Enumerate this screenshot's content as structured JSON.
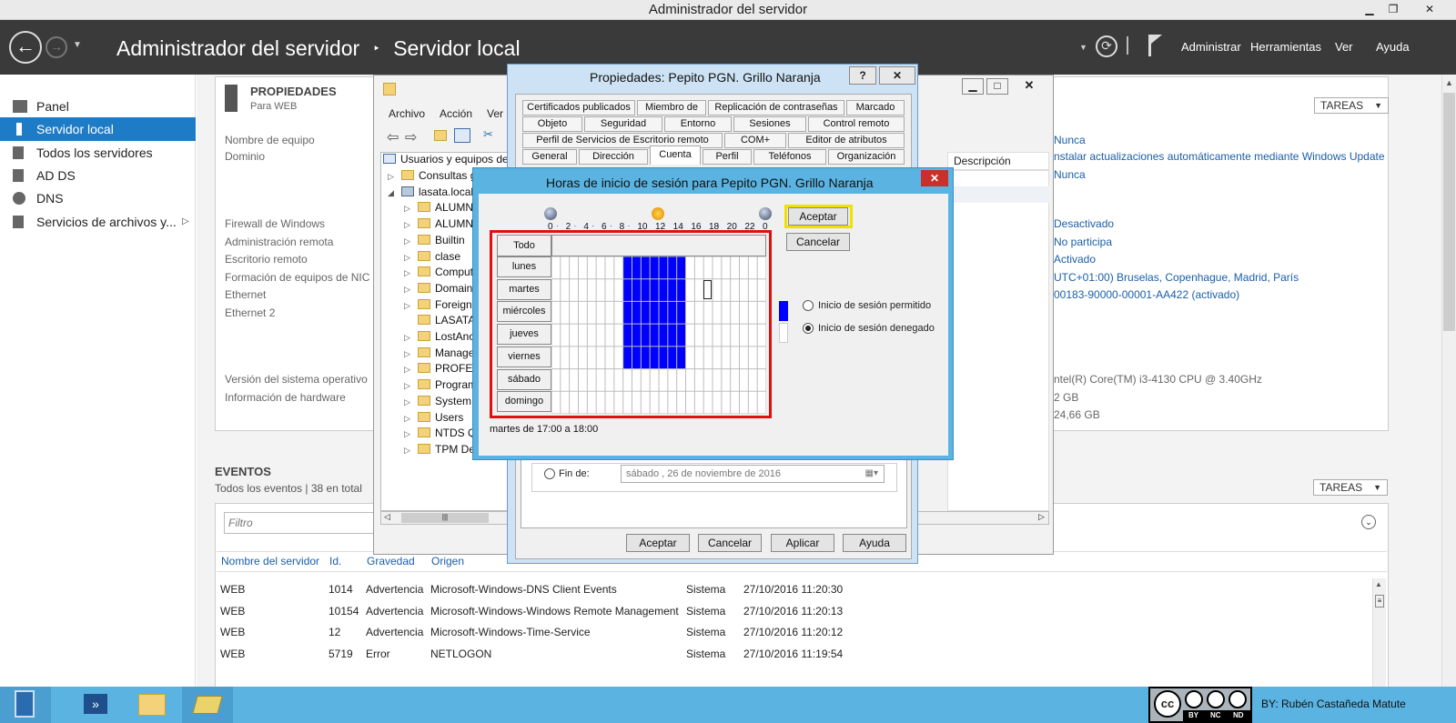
{
  "window": {
    "title": "Administrador del servidor",
    "min": "▁",
    "restore": "❐",
    "close": "✕"
  },
  "nav": {
    "breadcrumb_root": "Administrador del servidor",
    "breadcrumb_sep": "‣",
    "breadcrumb_page": "Servidor local",
    "menu": [
      "Administrar",
      "Herramientas",
      "Ver",
      "Ayuda"
    ]
  },
  "sidebar": {
    "items": [
      "Panel",
      "Servidor local",
      "Todos los servidores",
      "AD DS",
      "DNS",
      "Servicios de archivos y..."
    ]
  },
  "props": {
    "title": "PROPIEDADES",
    "subtitle": "Para WEB",
    "tasks": "TAREAS",
    "labels": [
      "Nombre de equipo",
      "Dominio",
      "Firewall de Windows",
      "Administración remota",
      "Escritorio remoto",
      "Formación de equipos de NIC",
      "Ethernet",
      "Ethernet 2",
      "Versión del sistema operativo",
      "Información de hardware"
    ],
    "right_values": [
      "Nunca",
      "nstalar actualizaciones automáticamente mediante Windows Update",
      "Nunca",
      "Desactivado",
      "No participa",
      "Activado",
      "UTC+01:00) Bruselas, Copenhague, Madrid, París",
      "00183-90000-00001-AA422 (activado)",
      "ntel(R) Core(TM) i3-4130 CPU @ 3.40GHz",
      "2 GB",
      "24,66 GB"
    ]
  },
  "events": {
    "title": "EVENTOS",
    "subtitle": "Todos los eventos | 38 en total",
    "tasks": "TAREAS",
    "filter_placeholder": "Filtro",
    "columns": [
      "Nombre del servidor",
      "Id.",
      "Gravedad",
      "Origen"
    ],
    "rows": [
      {
        "server": "WEB",
        "id": "1014",
        "sev": "Advertencia",
        "src": "Microsoft-Windows-DNS Client Events",
        "log": "Sistema",
        "date": "27/10/2016 11:20:30"
      },
      {
        "server": "WEB",
        "id": "10154",
        "sev": "Advertencia",
        "src": "Microsoft-Windows-Windows Remote Management",
        "log": "Sistema",
        "date": "27/10/2016 11:20:13"
      },
      {
        "server": "WEB",
        "id": "12",
        "sev": "Advertencia",
        "src": "Microsoft-Windows-Time-Service",
        "log": "Sistema",
        "date": "27/10/2016 11:20:12"
      },
      {
        "server": "WEB",
        "id": "5719",
        "sev": "Error",
        "src": "NETLOGON",
        "log": "Sistema",
        "date": "27/10/2016 11:19:54"
      }
    ]
  },
  "aduc": {
    "menu": [
      "Archivo",
      "Acción",
      "Ver"
    ],
    "tree_root": "Usuarios y equipos de",
    "desc_col": "Descripción",
    "tree": [
      "Consultas g",
      "lasata.local",
      "ALUMN",
      "ALUMN",
      "Builtin",
      "clase",
      "Comput",
      "Domain",
      "Foreign",
      "LASATA",
      "LostAnc",
      "Manage",
      "PROFES",
      "Program",
      "System",
      "Users",
      "NTDS Q",
      "TPM De"
    ]
  },
  "props_dialog": {
    "title": "Propiedades: Pepito PGN. Grillo Naranja",
    "help": "?",
    "close": "✕",
    "tabs_row1": [
      "Certificados publicados",
      "Miembro de",
      "Replicación de contraseñas",
      "Marcado"
    ],
    "tabs_row2": [
      "Objeto",
      "Seguridad",
      "Entorno",
      "Sesiones",
      "Control remoto"
    ],
    "tabs_row3": [
      "Perfil de Servicios de Escritorio remoto",
      "COM+",
      "Editor de atributos"
    ],
    "tabs_row4": [
      "General",
      "Dirección",
      "Cuenta",
      "Perfil",
      "Teléfonos",
      "Organización"
    ],
    "fin_label": "Fin de:",
    "fin_value": "sábado  , 26 de noviembre de 2016",
    "buttons": [
      "Aceptar",
      "Cancelar",
      "Aplicar",
      "Ayuda"
    ]
  },
  "hours_dialog": {
    "title": "Horas de inicio de sesión para Pepito PGN. Grillo Naranja",
    "close": "✕",
    "ticks": [
      "0",
      "2",
      "4",
      "6",
      "8",
      "10",
      "12",
      "14",
      "16",
      "18",
      "20",
      "22",
      "0"
    ],
    "all": "Todo",
    "days": [
      "lunes",
      "martes",
      "miércoles",
      "jueves",
      "viernes",
      "sábado",
      "domingo"
    ],
    "status": "martes de 17:00 a 18:00",
    "accept": "Aceptar",
    "cancel": "Cancelar",
    "opt_allowed": "Inicio de sesión permitido",
    "opt_denied": "Inicio de sesión denegado",
    "denied_hours_weekdays": [
      8,
      15
    ]
  },
  "license": {
    "by_text": "BY: Rubén Castañeda Matute",
    "cc_labels": [
      "BY",
      "NC",
      "ND"
    ]
  },
  "colors": {
    "accent": "#1e7bc6",
    "denied": "#0000ff",
    "highlight_red": "#e01010",
    "highlight_yellow": "#f0e000"
  }
}
